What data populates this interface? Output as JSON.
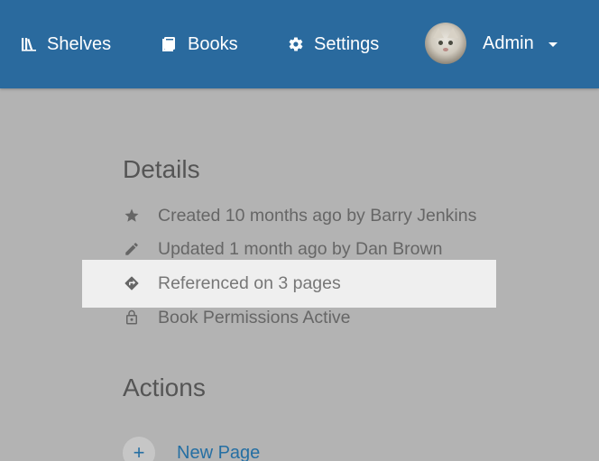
{
  "header": {
    "nav": [
      {
        "label": "Shelves",
        "icon": "shelves-icon"
      },
      {
        "label": "Books",
        "icon": "books-icon"
      },
      {
        "label": "Settings",
        "icon": "gear-icon"
      }
    ],
    "user": {
      "name": "Admin",
      "avatar": "cat-avatar"
    }
  },
  "details": {
    "title": "Details",
    "rows": [
      {
        "icon": "star-icon",
        "text": "Created 10 months ago by Barry Jenkins"
      },
      {
        "icon": "pencil-icon",
        "text": "Updated 1 month ago by Dan Brown"
      },
      {
        "icon": "reference-icon",
        "text": "Referenced on 3 pages"
      },
      {
        "icon": "lock-icon",
        "text": "Book Permissions Active"
      }
    ]
  },
  "actions": {
    "title": "Actions",
    "items": [
      {
        "icon": "plus-icon",
        "label": "New Page"
      }
    ]
  },
  "colors": {
    "header": "#2a6a9e",
    "backdrop": "#b3b3b3",
    "highlight": "#efefef",
    "link": "#256fa3"
  }
}
